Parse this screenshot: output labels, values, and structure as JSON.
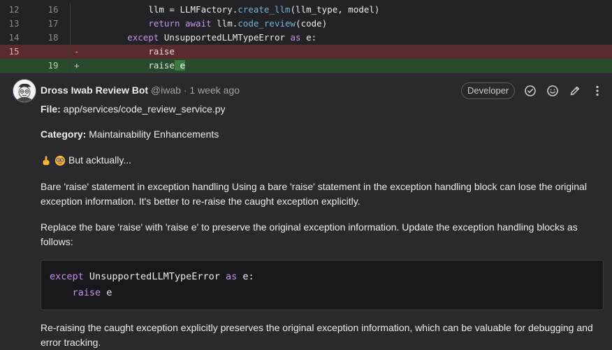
{
  "diff": {
    "lines": [
      {
        "old": "12",
        "new": "16",
        "mark": "",
        "type": "context"
      },
      {
        "old": "13",
        "new": "17",
        "mark": "",
        "type": "context"
      },
      {
        "old": "14",
        "new": "18",
        "mark": "",
        "type": "context"
      },
      {
        "old": "15",
        "new": "",
        "mark": "-",
        "type": "removed"
      },
      {
        "old": "",
        "new": "19",
        "mark": "+",
        "type": "added"
      }
    ],
    "code": {
      "l1": {
        "a": "llm = LLMFactory.",
        "b": "create_llm",
        "c": "(llm_type, model)"
      },
      "l2": {
        "a": "return await",
        "b": " llm.",
        "c": "code_review",
        "d": "(code)"
      },
      "l3": {
        "a": "except",
        "b": " UnsupportedLLMTypeError ",
        "c": "as",
        "d": " e:"
      },
      "l4": "raise",
      "l5": {
        "a": "raise",
        "b": " e"
      }
    }
  },
  "comment": {
    "author": "Dross Iwab Review Bot",
    "meta": " @iwab · 1 week ago",
    "role_badge": "Developer",
    "file_label": "File:",
    "file_value": " app/services/code_review_service.py",
    "category_label": "Category:",
    "category_value": " Maintainability Enhancements",
    "nerd_text": "But acktually...",
    "para1": "Bare 'raise' statement in exception handling Using a bare 'raise' statement in the exception handling block can lose the original exception information. It's better to re-raise the caught exception explicitly.",
    "para2": "Replace the bare 'raise' with 'raise e' to preserve the original exception information. Update the exception handling blocks as follows:",
    "code": {
      "l1_kw": "except",
      "l1_name": " UnsupportedLLMTypeError ",
      "l1_as": "as",
      "l1_rest": " e:",
      "l2_kw": "raise",
      "l2_rest": " e"
    },
    "para3": "Re-raising the caught exception explicitly preserves the original exception information, which can be valuable for debugging and error tracking."
  },
  "icons": [
    "resolve-check-icon",
    "emoji-reaction-icon",
    "edit-pencil-icon",
    "more-options-icon"
  ]
}
